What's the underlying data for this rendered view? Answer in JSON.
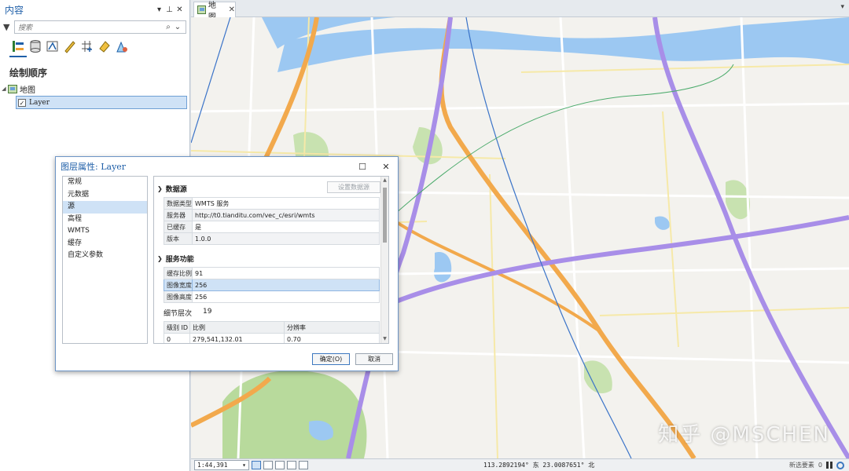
{
  "contents_pane": {
    "title": "内容",
    "search_placeholder": "搜索",
    "section_title": "绘制顺序",
    "map_item": "地图",
    "layer_item": "Layer"
  },
  "map_tab": {
    "label": "地图"
  },
  "dialog": {
    "title": "图层属性: Layer",
    "nav": [
      "常规",
      "元数据",
      "源",
      "高程",
      "WMTS",
      "缓存",
      "自定义参数"
    ],
    "selected_nav": "源",
    "datasource": {
      "header": "数据源",
      "set_button": "设置数据源",
      "rows": [
        {
          "key": "数据类型",
          "value": "WMTS 服务"
        },
        {
          "key": "服务器",
          "value": "http://t0.tianditu.com/vec_c/esri/wmts"
        },
        {
          "key": "已缓存",
          "value": "是"
        },
        {
          "key": "版本",
          "value": "1.0.0"
        }
      ]
    },
    "service": {
      "header": "服务功能",
      "rows": [
        {
          "key": "缓存比例",
          "value": "91"
        },
        {
          "key": "图像宽度",
          "value": "256"
        },
        {
          "key": "图像高度",
          "value": "256"
        }
      ],
      "detail_label": "细节层次",
      "detail_value": "19",
      "level_columns": [
        "级别 ID",
        "比例",
        "分辨率"
      ],
      "level_rows": [
        {
          "id": "0",
          "scale": "279,541,132.01",
          "resolution": "0.70"
        }
      ]
    },
    "ok_button": "确定(O)",
    "cancel_button": "取消"
  },
  "statusbar": {
    "scale": "1:44,391",
    "coordinates": "113.2892194° 东 23.0087651° 北",
    "new_features": "新选要素",
    "count": "0"
  },
  "watermark": "知乎 @MSCHEN"
}
